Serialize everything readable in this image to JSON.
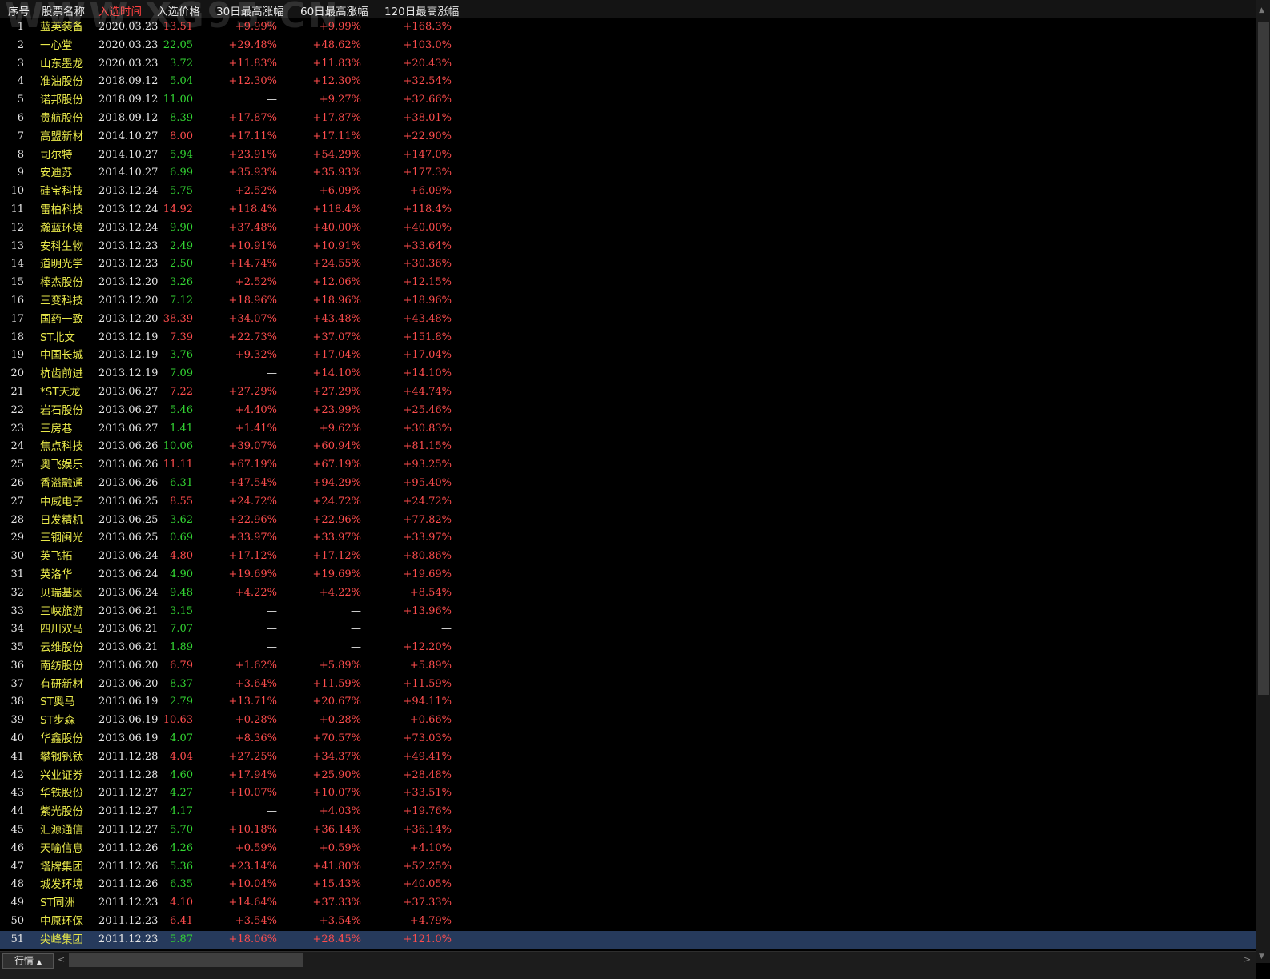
{
  "header": {
    "columns": [
      {
        "key": "idx",
        "label": "序号"
      },
      {
        "key": "name",
        "label": "股票名称"
      },
      {
        "key": "date",
        "label": "入选时间"
      },
      {
        "key": "price",
        "label": "入选价格"
      },
      {
        "key": "g30",
        "label": "30日最高涨幅"
      },
      {
        "key": "g60",
        "label": "60日最高涨幅"
      },
      {
        "key": "g120",
        "label": "120日最高涨幅"
      }
    ],
    "active_column": "date"
  },
  "watermark": "WWW.XG95.CN",
  "colors": {
    "red": "#ff4d4d",
    "green": "#33d633",
    "yellow": "#e8e84a",
    "selected_bg": "#263a5c"
  },
  "selected_row": 51,
  "bottom_tab": {
    "label": "行情",
    "caret": "▲"
  },
  "rows": [
    [
      "1",
      "蓝英装备",
      "2020.03.23",
      "13.51",
      "+9.99%",
      "+9.99%",
      "+168.3%",
      "red"
    ],
    [
      "2",
      "一心堂",
      "2020.03.23",
      "22.05",
      "+29.48%",
      "+48.62%",
      "+103.0%",
      "green"
    ],
    [
      "3",
      "山东墨龙",
      "2020.03.23",
      "3.72",
      "+11.83%",
      "+11.83%",
      "+20.43%",
      "green"
    ],
    [
      "4",
      "准油股份",
      "2018.09.12",
      "5.04",
      "+12.30%",
      "+12.30%",
      "+32.54%",
      "green"
    ],
    [
      "5",
      "诺邦股份",
      "2018.09.12",
      "11.00",
      "—",
      "+9.27%",
      "+32.66%",
      "green"
    ],
    [
      "6",
      "贵航股份",
      "2018.09.12",
      "8.39",
      "+17.87%",
      "+17.87%",
      "+38.01%",
      "green"
    ],
    [
      "7",
      "高盟新材",
      "2014.10.27",
      "8.00",
      "+17.11%",
      "+17.11%",
      "+22.90%",
      "red"
    ],
    [
      "8",
      "司尔特",
      "2014.10.27",
      "5.94",
      "+23.91%",
      "+54.29%",
      "+147.0%",
      "green"
    ],
    [
      "9",
      "安迪苏",
      "2014.10.27",
      "6.99",
      "+35.93%",
      "+35.93%",
      "+177.3%",
      "green"
    ],
    [
      "10",
      "硅宝科技",
      "2013.12.24",
      "5.75",
      "+2.52%",
      "+6.09%",
      "+6.09%",
      "green"
    ],
    [
      "11",
      "雷柏科技",
      "2013.12.24",
      "14.92",
      "+118.4%",
      "+118.4%",
      "+118.4%",
      "red"
    ],
    [
      "12",
      "瀚蓝环境",
      "2013.12.24",
      "9.90",
      "+37.48%",
      "+40.00%",
      "+40.00%",
      "green"
    ],
    [
      "13",
      "安科生物",
      "2013.12.23",
      "2.49",
      "+10.91%",
      "+10.91%",
      "+33.64%",
      "green"
    ],
    [
      "14",
      "道明光学",
      "2013.12.23",
      "2.50",
      "+14.74%",
      "+24.55%",
      "+30.36%",
      "green"
    ],
    [
      "15",
      "棒杰股份",
      "2013.12.20",
      "3.26",
      "+2.52%",
      "+12.06%",
      "+12.15%",
      "green"
    ],
    [
      "16",
      "三变科技",
      "2013.12.20",
      "7.12",
      "+18.96%",
      "+18.96%",
      "+18.96%",
      "green"
    ],
    [
      "17",
      "国药一致",
      "2013.12.20",
      "38.39",
      "+34.07%",
      "+43.48%",
      "+43.48%",
      "red"
    ],
    [
      "18",
      "ST北文",
      "2013.12.19",
      "7.39",
      "+22.73%",
      "+37.07%",
      "+151.8%",
      "red"
    ],
    [
      "19",
      "中国长城",
      "2013.12.19",
      "3.76",
      "+9.32%",
      "+17.04%",
      "+17.04%",
      "green"
    ],
    [
      "20",
      "杭齿前进",
      "2013.12.19",
      "7.09",
      "—",
      "+14.10%",
      "+14.10%",
      "green"
    ],
    [
      "21",
      "*ST天龙",
      "2013.06.27",
      "7.22",
      "+27.29%",
      "+27.29%",
      "+44.74%",
      "red"
    ],
    [
      "22",
      "岩石股份",
      "2013.06.27",
      "5.46",
      "+4.40%",
      "+23.99%",
      "+25.46%",
      "green"
    ],
    [
      "23",
      "三房巷",
      "2013.06.27",
      "1.41",
      "+1.41%",
      "+9.62%",
      "+30.83%",
      "green"
    ],
    [
      "24",
      "焦点科技",
      "2013.06.26",
      "10.06",
      "+39.07%",
      "+60.94%",
      "+81.15%",
      "green"
    ],
    [
      "25",
      "奥飞娱乐",
      "2013.06.26",
      "11.11",
      "+67.19%",
      "+67.19%",
      "+93.25%",
      "red"
    ],
    [
      "26",
      "香溢融通",
      "2013.06.26",
      "6.31",
      "+47.54%",
      "+94.29%",
      "+95.40%",
      "green"
    ],
    [
      "27",
      "中威电子",
      "2013.06.25",
      "8.55",
      "+24.72%",
      "+24.72%",
      "+24.72%",
      "red"
    ],
    [
      "28",
      "日发精机",
      "2013.06.25",
      "3.62",
      "+22.96%",
      "+22.96%",
      "+77.82%",
      "green"
    ],
    [
      "29",
      "三钢闽光",
      "2013.06.25",
      "0.69",
      "+33.97%",
      "+33.97%",
      "+33.97%",
      "green"
    ],
    [
      "30",
      "英飞拓",
      "2013.06.24",
      "4.80",
      "+17.12%",
      "+17.12%",
      "+80.86%",
      "red"
    ],
    [
      "31",
      "英洛华",
      "2013.06.24",
      "4.90",
      "+19.69%",
      "+19.69%",
      "+19.69%",
      "green"
    ],
    [
      "32",
      "贝瑞基因",
      "2013.06.24",
      "9.48",
      "+4.22%",
      "+4.22%",
      "+8.54%",
      "green"
    ],
    [
      "33",
      "三峡旅游",
      "2013.06.21",
      "3.15",
      "—",
      "—",
      "+13.96%",
      "green"
    ],
    [
      "34",
      "四川双马",
      "2013.06.21",
      "7.07",
      "—",
      "—",
      "—",
      "green"
    ],
    [
      "35",
      "云维股份",
      "2013.06.21",
      "1.89",
      "—",
      "—",
      "+12.20%",
      "green"
    ],
    [
      "36",
      "南纺股份",
      "2013.06.20",
      "6.79",
      "+1.62%",
      "+5.89%",
      "+5.89%",
      "red"
    ],
    [
      "37",
      "有研新材",
      "2013.06.20",
      "8.37",
      "+3.64%",
      "+11.59%",
      "+11.59%",
      "green"
    ],
    [
      "38",
      "ST奥马",
      "2013.06.19",
      "2.79",
      "+13.71%",
      "+20.67%",
      "+94.11%",
      "green"
    ],
    [
      "39",
      "ST步森",
      "2013.06.19",
      "10.63",
      "+0.28%",
      "+0.28%",
      "+0.66%",
      "red"
    ],
    [
      "40",
      "华鑫股份",
      "2013.06.19",
      "4.07",
      "+8.36%",
      "+70.57%",
      "+73.03%",
      "green"
    ],
    [
      "41",
      "攀钢钒钛",
      "2011.12.28",
      "4.04",
      "+27.25%",
      "+34.37%",
      "+49.41%",
      "red"
    ],
    [
      "42",
      "兴业证券",
      "2011.12.28",
      "4.60",
      "+17.94%",
      "+25.90%",
      "+28.48%",
      "green"
    ],
    [
      "43",
      "华铁股份",
      "2011.12.27",
      "4.27",
      "+10.07%",
      "+10.07%",
      "+33.51%",
      "green"
    ],
    [
      "44",
      "紫光股份",
      "2011.12.27",
      "4.17",
      "—",
      "+4.03%",
      "+19.76%",
      "green"
    ],
    [
      "45",
      "汇源通信",
      "2011.12.27",
      "5.70",
      "+10.18%",
      "+36.14%",
      "+36.14%",
      "green"
    ],
    [
      "46",
      "天喻信息",
      "2011.12.26",
      "4.26",
      "+0.59%",
      "+0.59%",
      "+4.10%",
      "green"
    ],
    [
      "47",
      "塔牌集团",
      "2011.12.26",
      "5.36",
      "+23.14%",
      "+41.80%",
      "+52.25%",
      "green"
    ],
    [
      "48",
      "城发环境",
      "2011.12.26",
      "6.35",
      "+10.04%",
      "+15.43%",
      "+40.05%",
      "green"
    ],
    [
      "49",
      "ST同洲",
      "2011.12.23",
      "4.10",
      "+14.64%",
      "+37.33%",
      "+37.33%",
      "red"
    ],
    [
      "50",
      "中原环保",
      "2011.12.23",
      "6.41",
      "+3.54%",
      "+3.54%",
      "+4.79%",
      "red"
    ],
    [
      "51",
      "尖峰集团",
      "2011.12.23",
      "5.87",
      "+18.06%",
      "+28.45%",
      "+121.0%",
      "green"
    ]
  ]
}
